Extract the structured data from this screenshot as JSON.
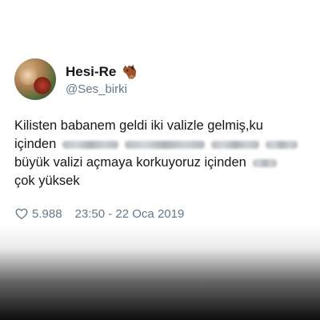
{
  "tweet": {
    "display_name": "Hesi-Re",
    "handle": "@Ses_birki",
    "lines": [
      "Kilisten babanem geldi iki valizle gelmiş,ku",
      "içinden",
      "büyük valizi açmaya korkuyoruz içinden",
      "çok yüksek"
    ],
    "likes": "5.988",
    "timestamp": "23:50 - 22 Oca 2019"
  },
  "icons": {
    "avatar": "profile-photo",
    "name_emoji": "horse-face-icon",
    "like": "heart-outline-icon"
  },
  "colors": {
    "text": "#14171a",
    "secondary": "#657786",
    "background": "#ffffff"
  }
}
